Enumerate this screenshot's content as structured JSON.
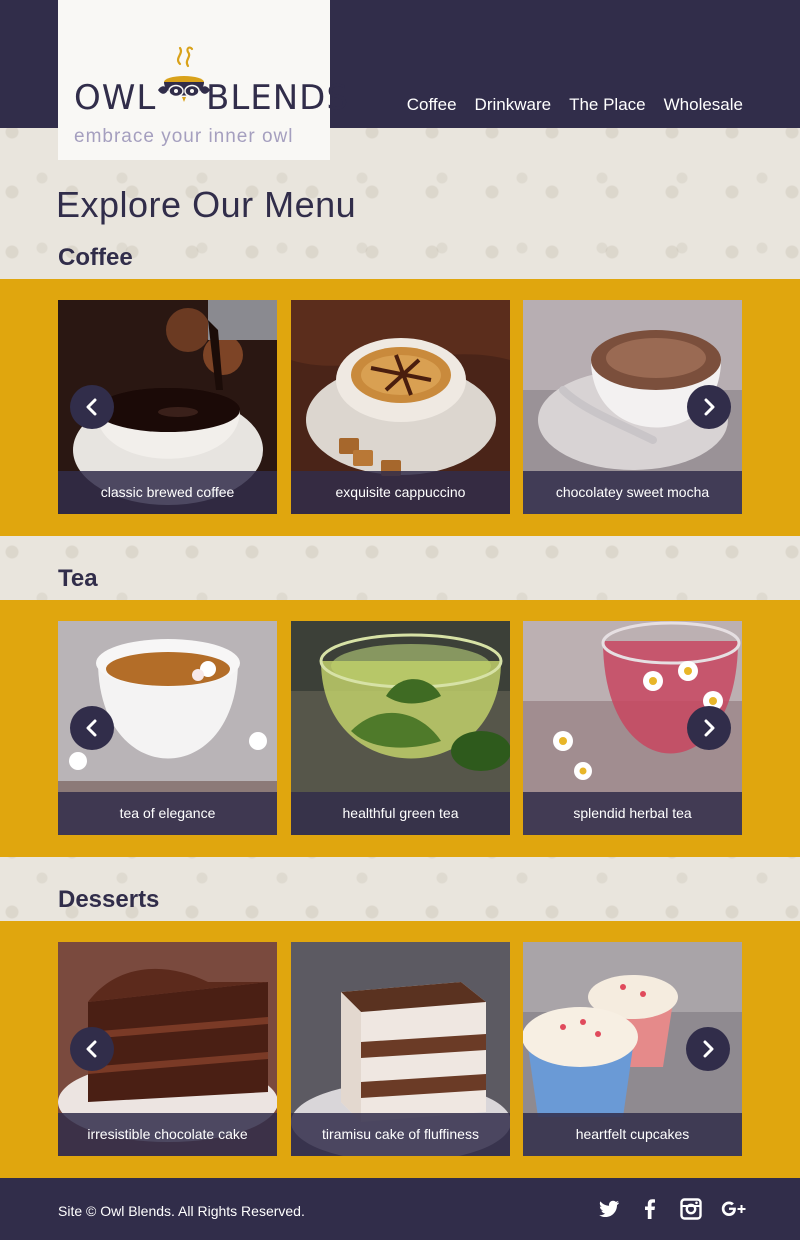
{
  "brand": {
    "logo_left": "OWL",
    "logo_right": "BLENDS",
    "tagline": "embrace your inner owl"
  },
  "nav": {
    "items": [
      {
        "label": "Coffee"
      },
      {
        "label": "Drinkware"
      },
      {
        "label": "The Place"
      },
      {
        "label": "Wholesale"
      }
    ]
  },
  "main": {
    "title": "Explore Our Menu",
    "sections": [
      {
        "title": "Coffee",
        "items": [
          {
            "label": "classic brewed coffee"
          },
          {
            "label": "exquisite cappuccino"
          },
          {
            "label": "chocolatey sweet mocha"
          }
        ]
      },
      {
        "title": "Tea",
        "items": [
          {
            "label": "tea of elegance"
          },
          {
            "label": "healthful green tea"
          },
          {
            "label": "splendid herbal tea"
          }
        ]
      },
      {
        "title": "Desserts",
        "items": [
          {
            "label": "irresistible chocolate cake"
          },
          {
            "label": "tiramisu cake of fluffiness"
          },
          {
            "label": "heartfelt cupcakes"
          }
        ]
      }
    ]
  },
  "footer": {
    "copyright": "Site © Owl Blends. All Rights Reserved.",
    "social_icons": [
      "twitter-icon",
      "facebook-icon",
      "instagram-icon",
      "google-plus-icon"
    ]
  },
  "colors": {
    "navy": "#312d4a",
    "mustard": "#e0a60e",
    "cream": "#e9e5dd",
    "accent_gold": "#d9a21a",
    "tagline": "#a59fbf"
  }
}
